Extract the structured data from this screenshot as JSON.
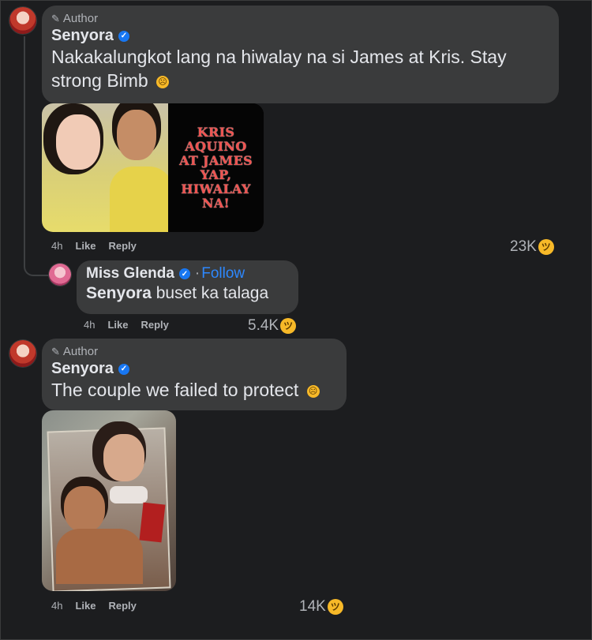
{
  "comment1": {
    "author_tag": "Author",
    "name": "Senyora",
    "text": "Nakakalungkot lang na hiwalay na si James at Kris. Stay strong Bimb",
    "emoji": "😦",
    "image_text": "KRIS\nAQUINO\nAT JAMES\nYAP,\nHIWALAY\nNA!",
    "time": "4h",
    "like_label": "Like",
    "reply_label": "Reply",
    "reaction_count": "23K",
    "reaction_emoji": "😆"
  },
  "reply1": {
    "name": "Miss Glenda",
    "separator": "·",
    "follow_label": "Follow",
    "mention": "Senyora",
    "text": " buset ka talaga",
    "time": "4h",
    "like_label": "Like",
    "reply_label": "Reply",
    "reaction_count": "5.4K",
    "reaction_emoji": "😆"
  },
  "comment2": {
    "author_tag": "Author",
    "name": "Senyora",
    "text": "The couple we failed to protect",
    "emoji": "😦",
    "time": "4h",
    "like_label": "Like",
    "reply_label": "Reply",
    "reaction_count": "14K",
    "reaction_emoji": "😆"
  },
  "colors": {
    "background": "#1c1d1f",
    "bubble": "#3a3b3c",
    "text": "#e4e6eb",
    "muted": "#b0b3b8",
    "verified": "#1877f2",
    "follow": "#2d88ff",
    "headline_red": "#ef5350"
  }
}
